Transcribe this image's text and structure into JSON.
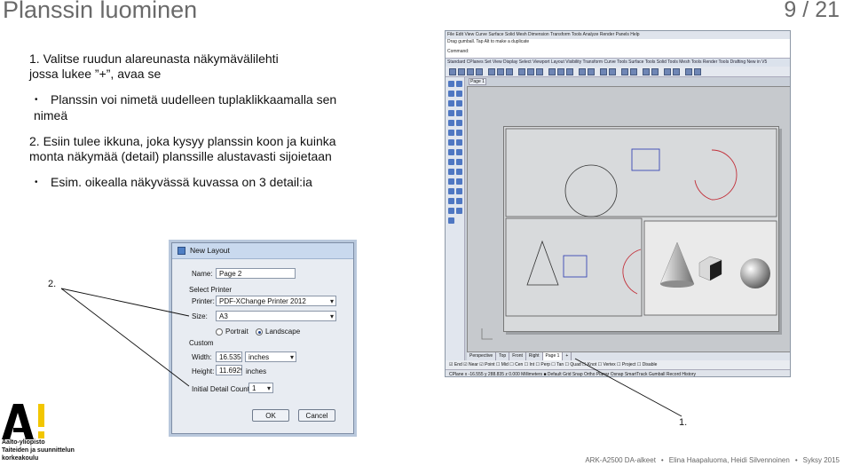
{
  "slide": {
    "title": "Planssin luominen",
    "page_number": "9",
    "page_total": "21",
    "page_sep": "/",
    "step1_line1": "1. Valitse ruudun alareunasta näkymävälilehti",
    "step1_line2": "jossa lukee ”+”, avaa se",
    "bullet1_line1": "Planssin voi nimetä uudelleen tuplaklikkaamalla sen",
    "bullet1_line2": "nimeä",
    "step2_line1": "2. Esiin tulee ikkuna, joka kysyy planssin koon ja kuinka",
    "step2_line2": "monta näkymää (detail) planssille alustavasti sijoietaan",
    "bullet2": "Esim. oikealla näkyvässä kuvassa on 3 detail:ia",
    "callout_2": "2.",
    "callout_1": "1."
  },
  "rhino": {
    "menubar": "File  Edit  View  Curve  Surface  Solid  Mesh  Dimension  Transform  Tools  Analyze  Render  Panels  Help",
    "cmd_history": "Drag gumball. Tap Alt to make a duplicate",
    "cmd_prompt": "Command:",
    "toolbar_tabs": "Standard   CPlanes   Set View   Display   Select   Viewport Layout   Visibility   Transform   Curve Tools   Surface Tools   Solid Tools   Mesh Tools   Render Tools   Drafting   New in V5",
    "layout_tab_top": "Page 1",
    "viewport_tabs": [
      "Perspective",
      "Top",
      "Front",
      "Right",
      "Page 1",
      "+"
    ],
    "osnaps": "☑ End  ☑ Near  ☑ Point  ☐ Mid  ☐ Cen  ☐ Int  ☐ Perp  ☐ Tan  ☐ Quad  ☐ Knot  ☐ Vertex  ☐ Project  ☐ Disable",
    "status": "CPlane   x -16.555   y 288.835   z 0.000      Millimeters   ■ Default          Grid Snap   Ortho   Planar   Osnap   SmartTrack   Gumball   Record History"
  },
  "dialog": {
    "title": "New Layout",
    "name_label": "Name:",
    "name_value": "Page 2",
    "select_printer_label": "Select Printer",
    "printer_label": "Printer:",
    "printer_value": "PDF-XChange Printer 2012",
    "size_label": "Size:",
    "size_value": "A3",
    "portrait_label": "Portrait",
    "landscape_label": "Landscape",
    "custom_label": "Custom",
    "width_label": "Width:",
    "width_value": "16.5354",
    "width_unit": "inches",
    "height_label": "Height:",
    "height_value": "11.6929",
    "height_unit": "inches",
    "detail_count_label": "Initial Detail Count:",
    "detail_count_value": "1",
    "ok_label": "OK",
    "cancel_label": "Cancel"
  },
  "footer": {
    "org_line1": "Aalto-yliopisto",
    "org_line2": "Taiteiden ja suunnittelun",
    "org_line3": "korkeakoulu",
    "course": "ARK-A2500 DA-alkeet",
    "authors": "Elina Haapaluoma, Heidi Silvennoinen",
    "term": "Syksy 2015"
  }
}
